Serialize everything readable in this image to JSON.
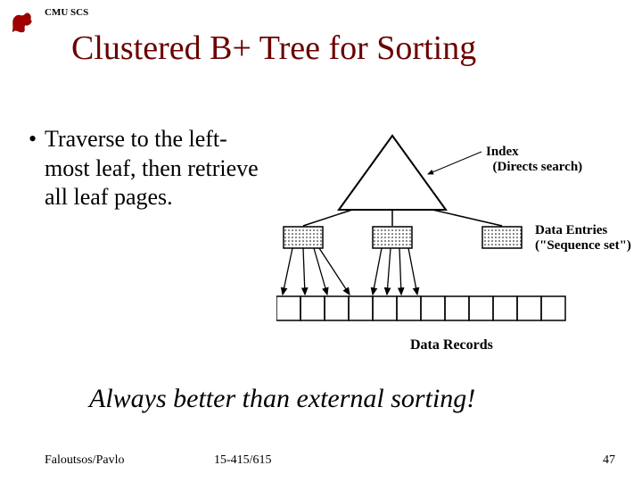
{
  "header": {
    "org": "CMU SCS"
  },
  "title": "Clustered B+ Tree for Sorting",
  "bullet": "Traverse to the left-most leaf, then retrieve all leaf pages.",
  "diagram": {
    "index_label_line1": "Index",
    "index_label_line2": "(Directs search)",
    "data_entries_line1": "Data Entries",
    "data_entries_line2": "(\"Sequence set\")",
    "records_label": "Data Records"
  },
  "quote": "Always better than external sorting!",
  "footer": {
    "authors": "Faloutsos/Pavlo",
    "course": "15-415/615",
    "page": "47"
  }
}
